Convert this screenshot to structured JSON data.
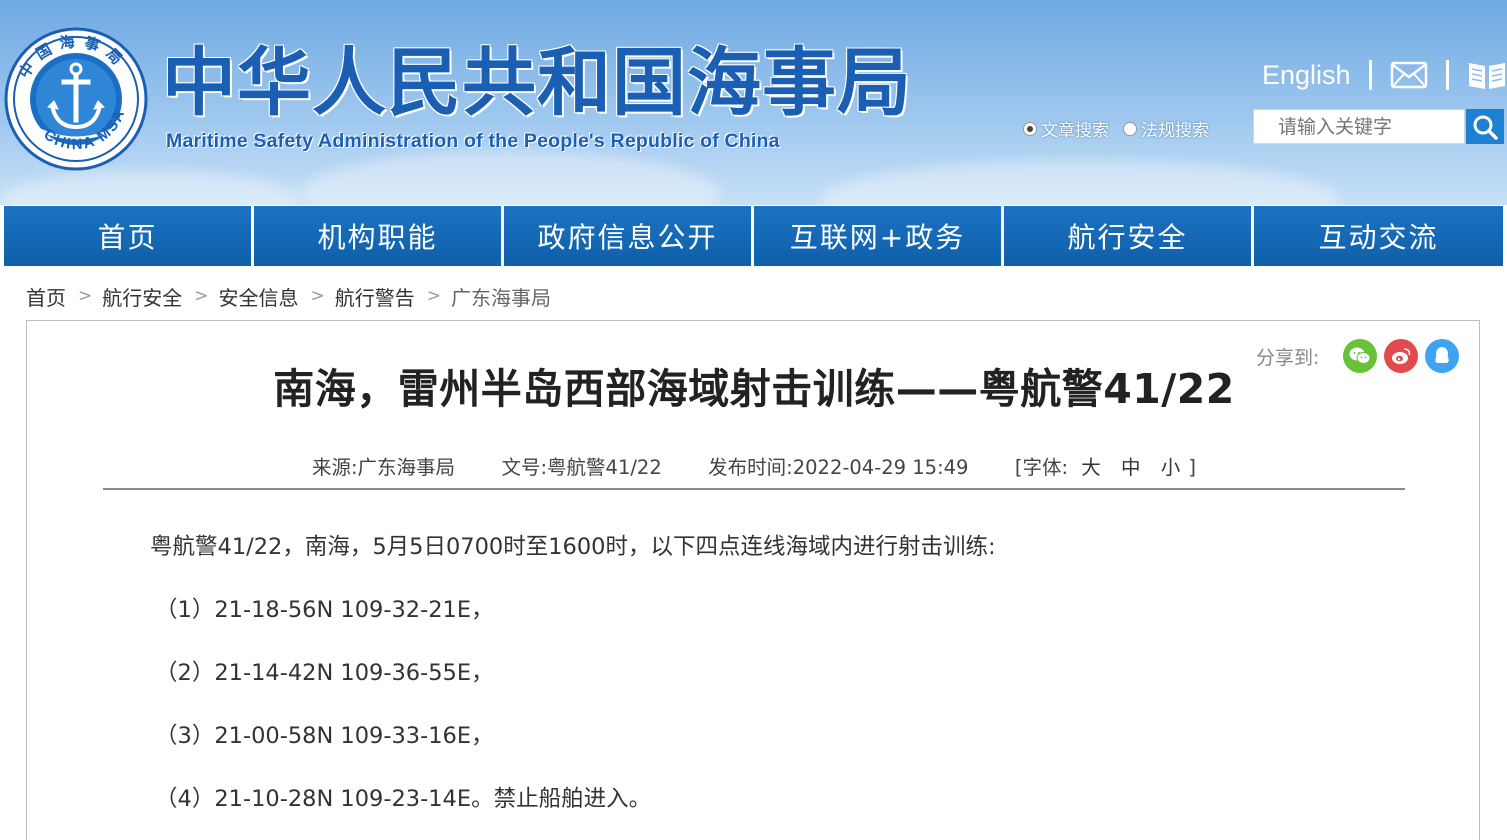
{
  "header": {
    "title_cn": "中华人民共和国海事局",
    "title_en": "Maritime Safety Administration of the People's Republic of China",
    "logo": {
      "top_text": "中国海事局",
      "bottom_text": "CHINA MSA",
      "icon": "anchor-emblem-icon"
    },
    "english_link": "English",
    "mail_icon": "mail-icon",
    "book_icon": "book-icon",
    "search": {
      "option_article": "文章搜索",
      "option_law": "法规搜索",
      "placeholder": "请输入关键字",
      "button_icon": "search-icon"
    },
    "colors": {
      "brand_blue": "#1a5fb4",
      "nav_blue": "#0f5fa9"
    }
  },
  "nav": {
    "items": [
      "首页",
      "机构职能",
      "政府信息公开",
      "互联网+政务",
      "航行安全",
      "互动交流"
    ]
  },
  "breadcrumb": {
    "items": [
      "首页",
      "航行安全",
      "安全信息",
      "航行警告",
      "广东海事局"
    ],
    "separator": ">"
  },
  "article": {
    "share_label": "分享到:",
    "share_icons": [
      "wechat-icon",
      "weibo-icon",
      "qq-icon"
    ],
    "title": "南海，雷州半岛西部海域射击训练——粤航警41/22",
    "meta": {
      "source_label": "来源:",
      "source": "广东海事局",
      "doc_label": "文号:",
      "doc_no": "粤航警41/22",
      "time_label": "发布时间:",
      "time": "2022-04-29 15:49",
      "font_open": "[字体:",
      "font_large": "大",
      "font_medium": "中",
      "font_small": "小",
      "font_close": "]"
    },
    "paragraphs": [
      "粤航警41/22，南海，5月5日0700时至1600时，以下四点连线海域内进行射击训练:",
      "（1）21-18-56N 109-32-21E，",
      "（2）21-14-42N 109-36-55E，",
      "（3）21-00-58N 109-33-16E，",
      "（4）21-10-28N 109-23-14E。禁止船舶进入。"
    ]
  }
}
